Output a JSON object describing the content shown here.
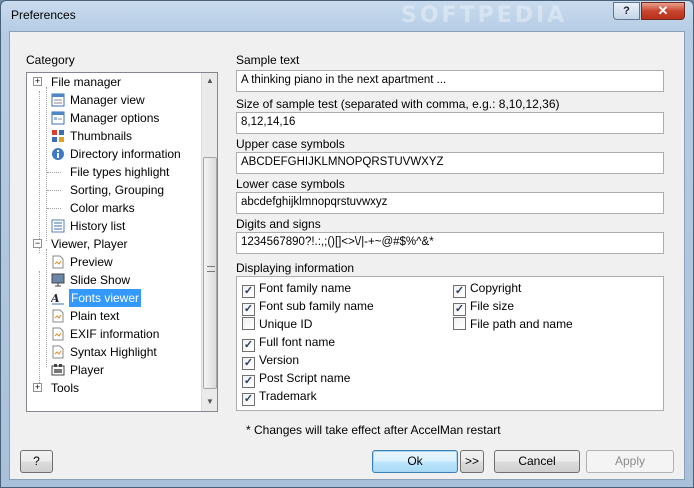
{
  "window": {
    "title": "Preferences",
    "watermark": "SOFTPEDIA",
    "help": "?",
    "close": "✕"
  },
  "category": {
    "label": "Category",
    "items": [
      {
        "label": "File manager",
        "expander": "+"
      },
      {
        "label": "Manager view"
      },
      {
        "label": "Manager options"
      },
      {
        "label": "Thumbnails"
      },
      {
        "label": "Directory information"
      },
      {
        "label": "File types highlight"
      },
      {
        "label": "Sorting, Grouping"
      },
      {
        "label": "Color marks"
      },
      {
        "label": "History list"
      },
      {
        "label": "Viewer, Player",
        "expander": "−"
      },
      {
        "label": "Preview"
      },
      {
        "label": "Slide Show"
      },
      {
        "label": "Fonts viewer"
      },
      {
        "label": "Plain text"
      },
      {
        "label": "EXIF information"
      },
      {
        "label": "Syntax Highlight"
      },
      {
        "label": "Player"
      },
      {
        "label": "Tools",
        "expander": "+"
      }
    ],
    "selected": "Fonts viewer"
  },
  "form": {
    "sample_text_label": "Sample text",
    "sample_text_value": "A thinking piano in the next apartment ...",
    "size_label": "Size of sample test (separated with comma, e.g.: 8,10,12,36)",
    "size_value": "8,12,14,16",
    "upper_label": "Upper case symbols",
    "upper_value": "ABCDEFGHIJKLMNOPQRSTUVWXYZ",
    "lower_label": "Lower case symbols",
    "lower_value": "abcdefghijklmnopqrstuvwxyz",
    "digits_label": "Digits and signs",
    "digits_value": "1234567890?!.:,;()[]<>\\/|-+~@#$%^&*",
    "display_label": "Displaying information"
  },
  "checkboxes": [
    {
      "label": "Font family name",
      "checked": true
    },
    {
      "label": "Font sub family name",
      "checked": true
    },
    {
      "label": "Unique ID",
      "checked": false
    },
    {
      "label": "Full font name",
      "checked": true
    },
    {
      "label": "Version",
      "checked": true
    },
    {
      "label": "Post Script name",
      "checked": true
    },
    {
      "label": "Trademark",
      "checked": true
    },
    {
      "label": "Copyright",
      "checked": true
    },
    {
      "label": "File size",
      "checked": true
    },
    {
      "label": "File path and name",
      "checked": false
    }
  ],
  "note": "* Changes will take effect after AccelMan restart",
  "buttons": {
    "help": "?",
    "ok": "Ok",
    "more": ">>",
    "cancel": "Cancel",
    "apply": "Apply"
  }
}
